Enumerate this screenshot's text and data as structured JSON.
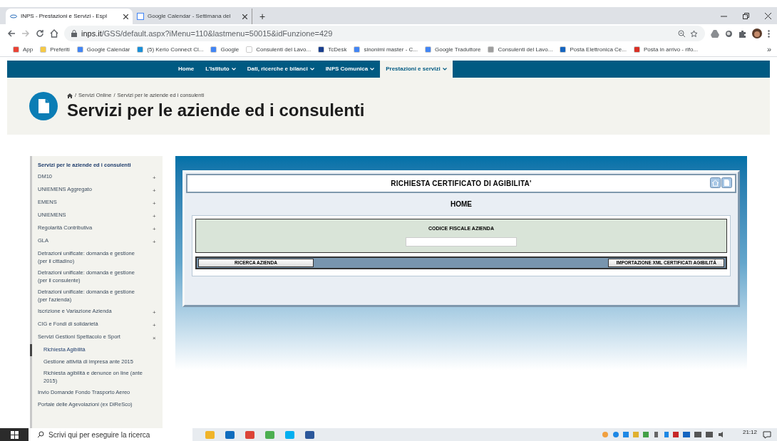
{
  "browser": {
    "tabs": [
      {
        "title": "INPS - Prestazioni e Servizi - Espl",
        "selected": true
      },
      {
        "title": "Google Calendar - Settimana del",
        "selected": false
      }
    ],
    "new_tab": "+",
    "address": {
      "host": "inps.it",
      "path": "/GSS/default.aspx?iMenu=110&lastmenu=50015&idFunzione=429"
    },
    "bookmarks": [
      {
        "label": "App",
        "color": "#ea4335"
      },
      {
        "label": "Preferiti",
        "color": "#f6c945"
      },
      {
        "label": "Google Calendar",
        "color": "#4285f4"
      },
      {
        "label": "(5) Kerio Connect Cl...",
        "color": "#1a8fd8"
      },
      {
        "label": "Google",
        "color": "#4285f4"
      },
      {
        "label": "Consulenti del Lavo...",
        "color": "#ffffff"
      },
      {
        "label": "TcDesk",
        "color": "#1a3f8f"
      },
      {
        "label": "sinonimi master - C...",
        "color": "#4285f4"
      },
      {
        "label": "Google Traduttore",
        "color": "#4285f4"
      },
      {
        "label": "Consulenti del Lavo...",
        "color": "#9e9e9e"
      },
      {
        "label": "Posta Elettronica Ce...",
        "color": "#1565c0"
      },
      {
        "label": "Posta in arrivo - rifo...",
        "color": "#d93025"
      }
    ],
    "more": "»"
  },
  "site_nav": [
    {
      "label": "Home",
      "dropdown": false,
      "selected": false
    },
    {
      "label": "L'Istituto",
      "dropdown": true,
      "selected": false
    },
    {
      "label": "Dati, ricerche e bilanci",
      "dropdown": true,
      "selected": false
    },
    {
      "label": "INPS Comunica",
      "dropdown": true,
      "selected": false
    },
    {
      "label": "Prestazioni e servizi",
      "dropdown": true,
      "selected": true
    }
  ],
  "breadcrumb": [
    "Servizi Online",
    "Servizi per le aziende ed i consulenti"
  ],
  "breadcrumb_separator": "/",
  "page_title": "Servizi per le aziende ed i consulenti",
  "sidebar": {
    "title": "Servizi per le aziende ed i consulenti",
    "items": [
      {
        "label": "DM10",
        "toggle": "+",
        "selected": false
      },
      {
        "label": "UNIEMENS Aggregato",
        "toggle": "+",
        "selected": false
      },
      {
        "label": "EMENS",
        "toggle": "+",
        "selected": false
      },
      {
        "label": "UNIEMENS",
        "toggle": "+",
        "selected": false
      },
      {
        "label": "Regolarità Contributiva",
        "toggle": "+",
        "selected": false
      },
      {
        "label": "GLA",
        "toggle": "+",
        "selected": false
      },
      {
        "label": "Detrazioni unificate: domanda e gestione (per il cittadino)",
        "selected": false
      },
      {
        "label": "Detrazioni unificate: domanda e gestione (per il consulente)",
        "selected": false
      },
      {
        "label": "Detrazioni unificate: domanda e gestione (per l'azienda)",
        "selected": false
      },
      {
        "label": "Iscrizione e Variazione Azienda",
        "toggle": "+",
        "selected": false
      },
      {
        "label": "CIG e Fondi di solidarietà",
        "toggle": "+",
        "selected": false
      },
      {
        "label": "Servizi Gestioni Spettacolo e Sport",
        "toggle": "×",
        "selected": false,
        "children": [
          {
            "label": "Richiesta Agibilità",
            "selected": true
          },
          {
            "label": "Gestione attività di impresa ante 2015",
            "selected": false
          },
          {
            "label": "Richiesta agibilità e denunce on line (ante 2015)",
            "selected": false
          }
        ]
      },
      {
        "label": "Invio Domande Fondo Trasporto Aereo",
        "selected": false
      },
      {
        "label": "Portale delle Agevolazioni (ex DiReSco)",
        "selected": false
      }
    ]
  },
  "app": {
    "title": "RICHIESTA CERTIFICATO DI AGIBILITA'",
    "section": "HOME",
    "field_label": "CODICE FISCALE AZIENDA",
    "buttons": [
      "RICERCA AZIENDA",
      "IMPORTAZIONE XML CERTIFICATI AGIBILITÁ"
    ]
  },
  "taskbar": {
    "search_placeholder": "Scrivi qui per eseguire la ricerca",
    "apps": [
      {
        "color": "#f0b429"
      },
      {
        "color": "#0f6cbd"
      },
      {
        "color": "#db4437"
      },
      {
        "color": "#4caf50"
      },
      {
        "color": "#00aff0"
      },
      {
        "color": "#2b579a"
      }
    ],
    "time": "21:12"
  }
}
